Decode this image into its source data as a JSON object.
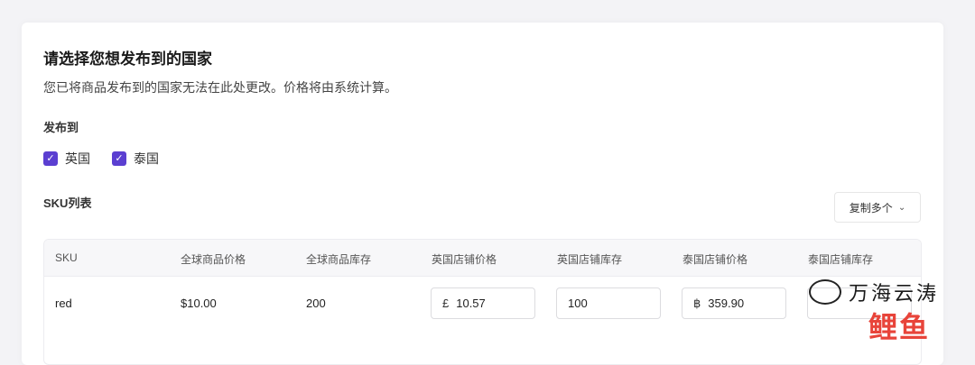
{
  "section": {
    "title": "请选择您想发布到的国家",
    "subtitle": "您已将商品发布到的国家无法在此处更改。价格将由系统计算。",
    "publish_label": "发布到",
    "countries": [
      {
        "label": "英国",
        "checked": true
      },
      {
        "label": "泰国",
        "checked": true
      }
    ],
    "sku_list_title": "SKU列表",
    "copy_multiple_label": "复制多个"
  },
  "table": {
    "headers": [
      "SKU",
      "全球商品价格",
      "全球商品库存",
      "英国店铺价格",
      "英国店铺库存",
      "泰国店铺价格",
      "泰国店铺库存"
    ],
    "rows": [
      {
        "sku": "red",
        "global_price": "$10.00",
        "global_stock": "200",
        "uk_price_prefix": "£",
        "uk_price": "10.57",
        "uk_stock": "100",
        "th_price_prefix": "฿",
        "th_price": "359.90",
        "th_stock": ""
      }
    ]
  },
  "watermark": {
    "line1": "万海云涛",
    "line2": "鲤鱼"
  },
  "colors": {
    "accent": "#5b3fd1",
    "background": "#f3f3f6"
  }
}
